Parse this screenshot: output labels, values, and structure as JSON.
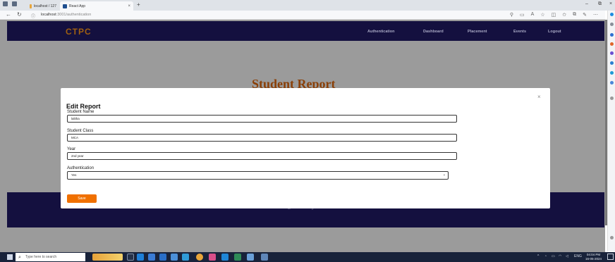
{
  "browser": {
    "tabs": [
      {
        "label": "localhost / 127.0.0.1 / placemen",
        "active": false
      },
      {
        "label": "React App",
        "active": true
      }
    ],
    "url_host": "localhost",
    "url_path": ":3001/authentication"
  },
  "app": {
    "brand": "CTPC",
    "nav": [
      "Authentication",
      "Dashboard",
      "Placement",
      "Events",
      "Logout"
    ],
    "page_title": "Student Report",
    "footer": "© CTPC @2024. All right reserved"
  },
  "modal": {
    "title": "Edit Report",
    "close": "×",
    "fields": [
      {
        "label": "Student Name",
        "value": "lalitha"
      },
      {
        "label": "Student Class",
        "value": "MCA"
      },
      {
        "label": "Year",
        "value": "2nd year"
      },
      {
        "label": "Authentication",
        "value": "Yes"
      }
    ],
    "save_label": "Save"
  },
  "taskbar": {
    "search_placeholder": "Type here to search",
    "lang": "ENG",
    "time": "04:04 PM",
    "date": "16-05-2024"
  },
  "colors": {
    "navbar": "#14103f",
    "brand": "#a06010",
    "title": "#8a3f07",
    "save": "#f07000",
    "overlay": "#9b9b9b"
  }
}
